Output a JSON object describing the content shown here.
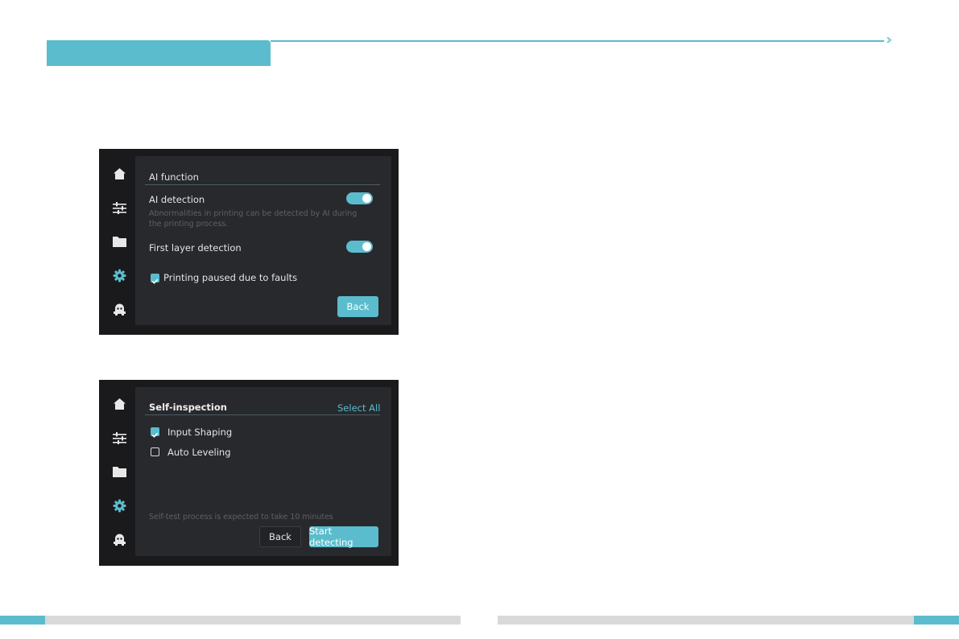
{
  "colors": {
    "accent": "#5bbccd",
    "footer_gray": "#d9d9d9",
    "screen_bg": "#1a1a1c",
    "panel_bg": "#28292d"
  },
  "header": {
    "arrows": [
      "›",
      "›",
      "›"
    ]
  },
  "sidebar_icons": [
    "home-icon",
    "sliders-icon",
    "folder-icon",
    "gear-icon",
    "robot-icon"
  ],
  "ai_screen": {
    "title": "AI function",
    "ai_detection": {
      "label": "AI detection",
      "description": "Abnormalities in printing can be detected by AI during the printing process.",
      "enabled": true
    },
    "first_layer": {
      "label": "First layer detection",
      "enabled": true
    },
    "pause_on_fault": {
      "label": "Printing paused due to faults",
      "checked": true
    },
    "back_label": "Back"
  },
  "self_inspection": {
    "title": "Self-inspection",
    "select_all": "Select All",
    "items": [
      {
        "label": "Input Shaping",
        "checked": true
      },
      {
        "label": "Auto Leveling",
        "checked": false
      }
    ],
    "note": "Self-test process is expected to take 10 minutes",
    "back_label": "Back",
    "start_label": "Start detecting"
  }
}
